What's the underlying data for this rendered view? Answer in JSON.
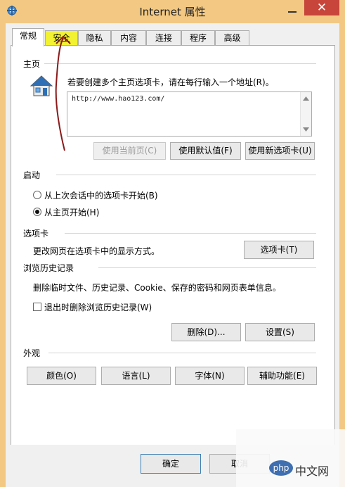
{
  "window": {
    "title": "Internet 属性",
    "close_symbol": "✕"
  },
  "tabs": [
    {
      "label": "常规",
      "active": true
    },
    {
      "label": "安全",
      "highlight": true
    },
    {
      "label": "隐私"
    },
    {
      "label": "内容"
    },
    {
      "label": "连接"
    },
    {
      "label": "程序"
    },
    {
      "label": "高级"
    }
  ],
  "home": {
    "section": "主页",
    "hint": "若要创建多个主页选项卡，请在每行输入一个地址(R)。",
    "url": "http://www.hao123.com/",
    "buttons": {
      "use_current": "使用当前页(C)",
      "use_default": "使用默认值(F)",
      "use_new_tab": "使用新选项卡(U)"
    }
  },
  "startup": {
    "section": "启动",
    "option_last_session": "从上次会话中的选项卡开始(B)",
    "option_home": "从主页开始(H)",
    "selected": "option_home"
  },
  "tabs_section": {
    "section": "选项卡",
    "desc": "更改网页在选项卡中的显示方式。",
    "button": "选项卡(T)"
  },
  "history": {
    "section": "浏览历史记录",
    "desc": "删除临时文件、历史记录、Cookie、保存的密码和网页表单信息。",
    "checkbox": "退出时删除浏览历史记录(W)",
    "checked": false,
    "delete_btn": "删除(D)...",
    "settings_btn": "设置(S)"
  },
  "appearance": {
    "section": "外观",
    "colors": "颜色(O)",
    "languages": "语言(L)",
    "fonts": "字体(N)",
    "accessibility": "辅助功能(E)"
  },
  "footer": {
    "ok": "确定",
    "cancel": "取消"
  },
  "watermark": {
    "logo": "php",
    "site": "中文网"
  },
  "accent_colors": {
    "titlebar": "#F2C882",
    "close": "#C7453A",
    "annotation": "#8B1A1A",
    "highlight": "#F2F232"
  }
}
